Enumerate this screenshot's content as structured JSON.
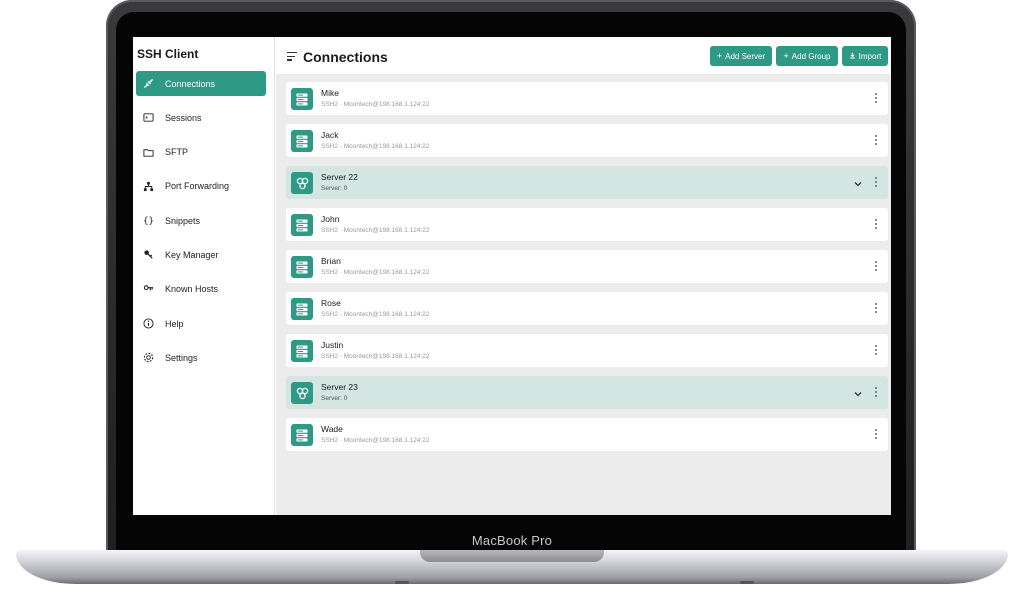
{
  "device_label": "MacBook Pro",
  "app": {
    "title": "SSH Client"
  },
  "sidebar": {
    "items": [
      {
        "label": "Connections",
        "icon": "connections-icon",
        "active": true
      },
      {
        "label": "Sessions",
        "icon": "terminal-icon",
        "active": false
      },
      {
        "label": "SFTP",
        "icon": "folder-icon",
        "active": false
      },
      {
        "label": "Port Forwarding",
        "icon": "network-icon",
        "active": false
      },
      {
        "label": "Snippets",
        "icon": "braces-icon",
        "active": false
      },
      {
        "label": "Key Manager",
        "icon": "key-icon",
        "active": false
      },
      {
        "label": "Known Hosts",
        "icon": "hosts-icon",
        "active": false
      },
      {
        "label": "Help",
        "icon": "info-icon",
        "active": false
      },
      {
        "label": "Settings",
        "icon": "gear-icon",
        "active": false
      }
    ]
  },
  "header": {
    "title": "Connections",
    "buttons": {
      "add_server": "Add Server",
      "add_group": "Add Group",
      "import": "Import"
    }
  },
  "connections": [
    {
      "type": "server",
      "name": "Mike",
      "detail": "SSH2 · Moontech@198.168.1.124:22"
    },
    {
      "type": "server",
      "name": "Jack",
      "detail": "SSH2 · Moontech@198.168.1.124:22"
    },
    {
      "type": "group",
      "name": "Server 22",
      "detail": "Server: 0"
    },
    {
      "type": "server",
      "name": "John",
      "detail": "SSH2 · Moontech@198.168.1.124:22"
    },
    {
      "type": "server",
      "name": "Brian",
      "detail": "SSH2 · Moontech@198.168.1.124:22"
    },
    {
      "type": "server",
      "name": "Rose",
      "detail": "SSH2 · Moontech@198.168.1.124:22"
    },
    {
      "type": "server",
      "name": "Justin",
      "detail": "SSH2 · Moontech@198.168.1.124:22"
    },
    {
      "type": "group",
      "name": "Server 23",
      "detail": "Server: 0"
    },
    {
      "type": "server",
      "name": "Wade",
      "detail": "SSH2 · Moontech@198.168.1.124:22"
    }
  ],
  "colors": {
    "accent": "#2e9a86",
    "group_row": "#d3e6e2",
    "panel": "#ececec"
  }
}
